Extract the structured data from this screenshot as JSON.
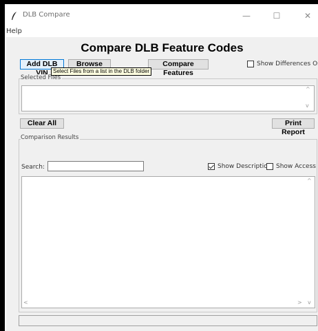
{
  "window": {
    "title": "DLB Compare",
    "min_symbol": "—",
    "max_symbol": "☐",
    "close_symbol": "✕"
  },
  "menu": {
    "help": "Help"
  },
  "heading": "Compare DLB Feature Codes",
  "toolbar": {
    "add_vin": "Add DLB VIN",
    "browse_files": "Browse Files",
    "compare_features": "Compare Features",
    "show_differences": "Show Differences Only"
  },
  "tooltip": "Select Files from a list in the DLB folder",
  "selected_files": {
    "label": "Selected Files"
  },
  "actions": {
    "clear_all": "Clear All",
    "print_report": "Print Report"
  },
  "results": {
    "label": "Comparison Results",
    "search_label": "Search:",
    "search_value": "",
    "show_description": "Show Description",
    "show_access": "Show Access"
  },
  "checkbox_state": {
    "show_differences": false,
    "show_description": true,
    "show_access": false
  }
}
